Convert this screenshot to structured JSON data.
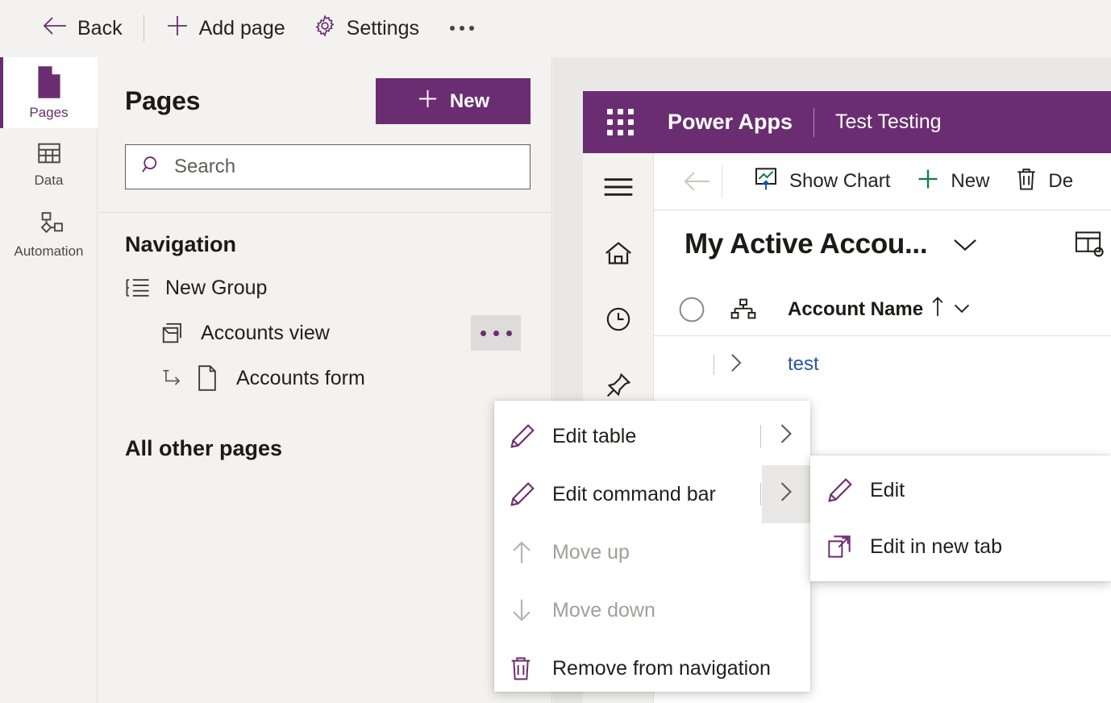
{
  "topbar": {
    "back_label": "Back",
    "add_page_label": "Add page",
    "settings_label": "Settings",
    "more_label": "More commands"
  },
  "rail": {
    "items": [
      {
        "label": "Pages",
        "icon": "page-icon",
        "selected": true
      },
      {
        "label": "Data",
        "icon": "table-icon",
        "selected": false
      },
      {
        "label": "Automation",
        "icon": "flow-icon",
        "selected": false
      }
    ]
  },
  "pages_panel": {
    "title": "Pages",
    "new_button": "New",
    "search_placeholder": "Search",
    "search_value": "",
    "navigation_title": "Navigation",
    "tree": [
      {
        "label": "New Group",
        "level": 1,
        "icon": "group-list-icon"
      },
      {
        "label": "Accounts view",
        "level": 2,
        "icon": "view-icon",
        "has_ellipsis": true
      },
      {
        "label": "Accounts form",
        "level": 3,
        "icon": "form-page-icon"
      }
    ],
    "all_other_pages_title": "All other pages"
  },
  "context_menu": {
    "items": [
      {
        "label": "Edit table",
        "icon": "pencil-icon",
        "disabled": false,
        "submenu": true,
        "submenu_open": false
      },
      {
        "label": "Edit command bar",
        "icon": "pencil-icon",
        "disabled": false,
        "submenu": true,
        "submenu_open": true
      },
      {
        "label": "Move up",
        "icon": "arrow-up-icon",
        "disabled": true,
        "submenu": false
      },
      {
        "label": "Move down",
        "icon": "arrow-down-icon",
        "disabled": true,
        "submenu": false
      },
      {
        "label": "Remove from navigation",
        "icon": "trash-icon",
        "disabled": false,
        "submenu": false
      }
    ]
  },
  "submenu": {
    "items": [
      {
        "label": "Edit",
        "icon": "pencil-icon"
      },
      {
        "label": "Edit in new tab",
        "icon": "open-in-new-tab-icon"
      }
    ]
  },
  "app_preview": {
    "header": {
      "product_name": "Power Apps",
      "environment_name": "Test Testing",
      "waffle_icon": "waffle-icon"
    },
    "rail_icons": [
      "hamburger-icon",
      "home-icon",
      "recent-clock-icon",
      "pin-icon"
    ],
    "command_bar": {
      "back_icon": "arrow-left-icon",
      "buttons": [
        {
          "label": "Show Chart",
          "icon": "chart-icon"
        },
        {
          "label": "New",
          "icon": "plus-icon"
        },
        {
          "label": "De",
          "icon": "trash-icon"
        }
      ]
    },
    "view": {
      "name": "My Active Accou...",
      "chevron_icon": "chevron-down-icon",
      "edit_columns_icon": "edit-columns-icon"
    },
    "grid": {
      "select_all_icon": "circle-select-icon",
      "hierarchy_icon": "hierarchy-icon",
      "columns": [
        {
          "label": "Account Name",
          "sort": "ascending",
          "sort_icon": "arrow-up-icon",
          "chevron_icon": "chevron-down-icon"
        }
      ],
      "rows": [
        {
          "expand_icon": "chevron-right-icon",
          "account_name": "test"
        }
      ]
    }
  },
  "colors": {
    "brand_purple": "#6b2d71",
    "panel_bg": "#f3f2f1",
    "link_blue": "#2b579a",
    "disabled_gray": "#a19f9d"
  }
}
